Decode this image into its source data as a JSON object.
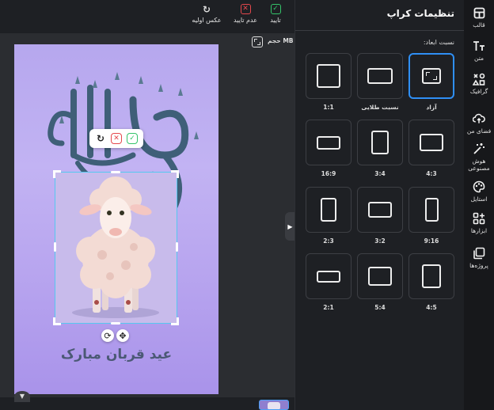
{
  "toolbar": {
    "approve_label": "تایید",
    "reject_label": "عدم تایید",
    "original_label": "عکس اولیه"
  },
  "size": {
    "label": "حجم MB"
  },
  "canvas": {
    "greeting_text": "عید قربان مبارک"
  },
  "colors": {
    "accent": "#2f8ff5",
    "approve": "#34c46a",
    "reject": "#e5484d",
    "crop_frame": "#56c8f0"
  },
  "panel": {
    "title": "تنظیمات کراپ",
    "ratio_label": "نسبت ابعاد:",
    "options": [
      {
        "label": "آزاد",
        "selected": true
      },
      {
        "label": "نسبت طلایی"
      },
      {
        "label": "1:1"
      },
      {
        "label": "4:3"
      },
      {
        "label": "3:4"
      },
      {
        "label": "16:9"
      },
      {
        "label": "9:16"
      },
      {
        "label": "3:2"
      },
      {
        "label": "2:3"
      },
      {
        "label": "4:5"
      },
      {
        "label": "5:4"
      },
      {
        "label": "2:1"
      }
    ]
  },
  "sidebar": {
    "items": [
      {
        "label": "قالب",
        "icon": "layout-icon"
      },
      {
        "label": "متن",
        "icon": "text-icon"
      },
      {
        "label": "گرافیک",
        "icon": "shapes-icon"
      },
      {
        "label": "فضای من",
        "icon": "cloud-upload-icon"
      },
      {
        "label": "هوش مصنوعی",
        "icon": "magic-wand-icon"
      },
      {
        "label": "استایل",
        "icon": "palette-icon"
      },
      {
        "label": "ابزارها",
        "icon": "tools-icon"
      },
      {
        "label": "پروژه‌ها",
        "icon": "projects-icon"
      }
    ]
  }
}
